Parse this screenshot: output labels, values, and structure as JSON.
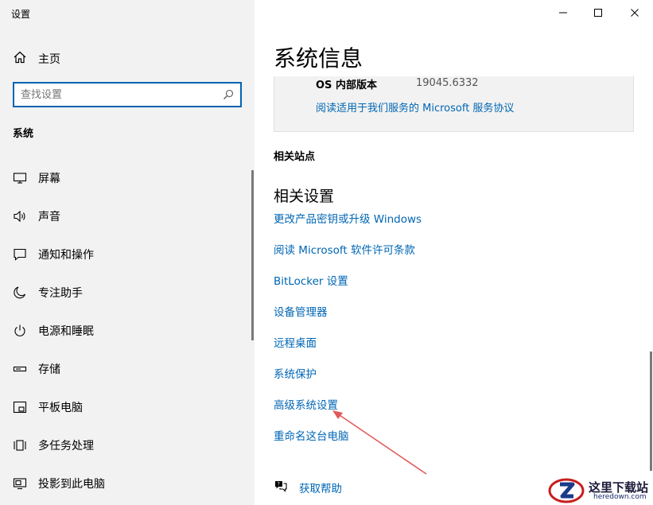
{
  "window": {
    "title": "设置",
    "controls": [
      "minimize",
      "maximize",
      "close"
    ]
  },
  "sidebar": {
    "home_label": "主页",
    "search": {
      "placeholder": "查找设置",
      "value": ""
    },
    "section_heading": "系统",
    "items": [
      {
        "label": "屏幕",
        "icon": "display-icon"
      },
      {
        "label": "声音",
        "icon": "speaker-icon"
      },
      {
        "label": "通知和操作",
        "icon": "notification-icon"
      },
      {
        "label": "专注助手",
        "icon": "moon-icon"
      },
      {
        "label": "电源和睡眠",
        "icon": "power-icon"
      },
      {
        "label": "存储",
        "icon": "storage-icon"
      },
      {
        "label": "平板电脑",
        "icon": "tablet-icon"
      },
      {
        "label": "多任务处理",
        "icon": "multitask-icon"
      },
      {
        "label": "投影到此电脑",
        "icon": "project-icon"
      }
    ]
  },
  "main": {
    "title": "系统信息",
    "os_build": {
      "label": "OS 内部版本",
      "value": "19045.6332"
    },
    "service_agreement_link": "阅读适用于我们服务的 Microsoft 服务协议",
    "related_sites_heading": "相关站点",
    "related_settings_heading": "相关设置",
    "related_links": [
      "更改产品密钥或升级 Windows",
      "阅读 Microsoft 软件许可条款",
      "BitLocker 设置",
      "设备管理器",
      "远程桌面",
      "系统保护",
      "高级系统设置",
      "重命名这台电脑"
    ],
    "help_label": "获取帮助"
  },
  "watermark": {
    "text": "这里下载站",
    "sub": "heredown.com"
  },
  "colors": {
    "accent": "#0066b4",
    "sidebar_bg": "#f2f2f2",
    "arrow": "#e05a5a"
  }
}
